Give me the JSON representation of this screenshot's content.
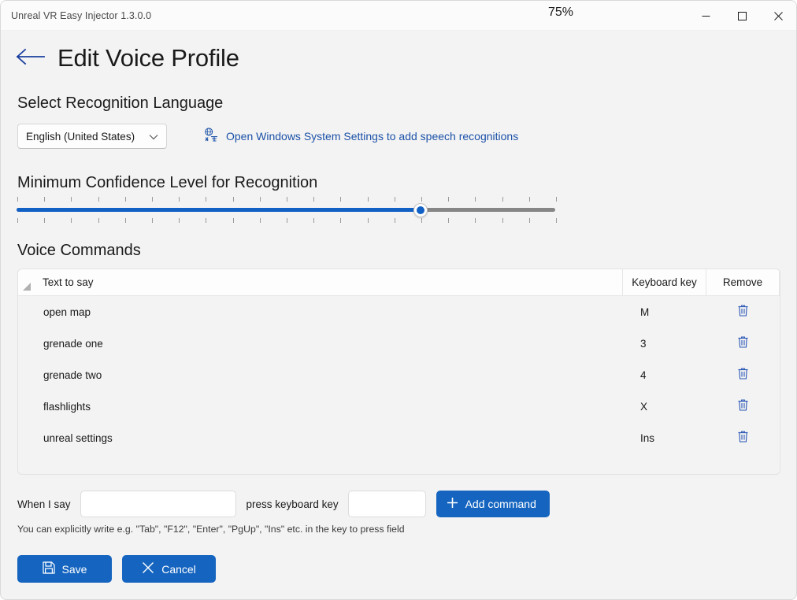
{
  "window": {
    "title": "Unreal VR Easy Injector 1.3.0.0",
    "controls": {
      "minimize": "Minimize",
      "maximize": "Maximize",
      "close": "Close"
    }
  },
  "header": {
    "back_icon": "arrow-left-icon",
    "title": "Edit Voice Profile"
  },
  "language_section": {
    "heading": "Select Recognition Language",
    "dropdown": {
      "value": "English (United States)",
      "chevron": "chevron-down-icon"
    },
    "link": {
      "icon": "translate-icon",
      "text": "Open Windows System Settings to add speech recognitions"
    }
  },
  "confidence_section": {
    "heading": "Minimum Confidence Level for Recognition",
    "value_label": "75%",
    "value": 75,
    "min": 0,
    "max": 100,
    "tick_count": 21
  },
  "commands_section": {
    "heading": "Voice Commands",
    "columns": {
      "corner": "sort-indicator-icon",
      "text": "Text to say",
      "key": "Keyboard key",
      "remove": "Remove"
    },
    "rows": [
      {
        "text": "open map",
        "key": "M",
        "remove_icon": "trash-icon"
      },
      {
        "text": "grenade one",
        "key": "3",
        "remove_icon": "trash-icon"
      },
      {
        "text": "grenade two",
        "key": "4",
        "remove_icon": "trash-icon"
      },
      {
        "text": "flashlights",
        "key": "X",
        "remove_icon": "trash-icon"
      },
      {
        "text": "unreal settings",
        "key": "Ins",
        "remove_icon": "trash-icon"
      }
    ]
  },
  "add_form": {
    "when_label": "When I say",
    "when_value": "",
    "when_placeholder": "",
    "press_label": "press keyboard key",
    "key_value": "",
    "key_placeholder": "",
    "add_button": {
      "icon": "plus-icon",
      "label": "Add command"
    },
    "hint": "You can explicitly write e.g. \"Tab\", \"F12\", \"Enter\", \"PgUp\", \"Ins\" etc. in the key to press field"
  },
  "footer": {
    "save": {
      "icon": "save-icon",
      "label": "Save"
    },
    "cancel": {
      "icon": "close-x-icon",
      "label": "Cancel"
    }
  },
  "colors": {
    "accent": "#1565c0",
    "slider_fill": "#1160c4",
    "link": "#1b51a8",
    "page_bg": "#f3f3f3",
    "titlebar_bg": "#fbfbfb"
  }
}
